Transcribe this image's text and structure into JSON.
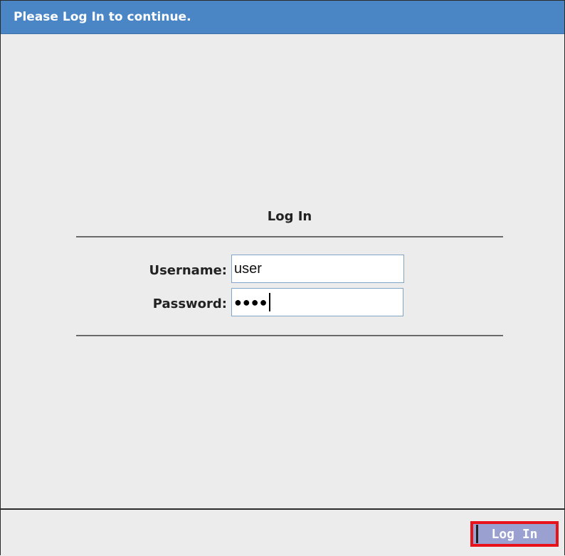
{
  "window": {
    "title": "Please Log In to continue."
  },
  "form": {
    "heading": "Log In",
    "username_label": "Username:",
    "username_value": "user",
    "password_label": "Password:",
    "password_masked": "●●●●"
  },
  "footer": {
    "login_button_label": "Log In"
  },
  "colors": {
    "titlebar": "#4a86c5",
    "background": "#ececec",
    "button": "#9aa0d0",
    "highlight_border": "#e8121b"
  }
}
